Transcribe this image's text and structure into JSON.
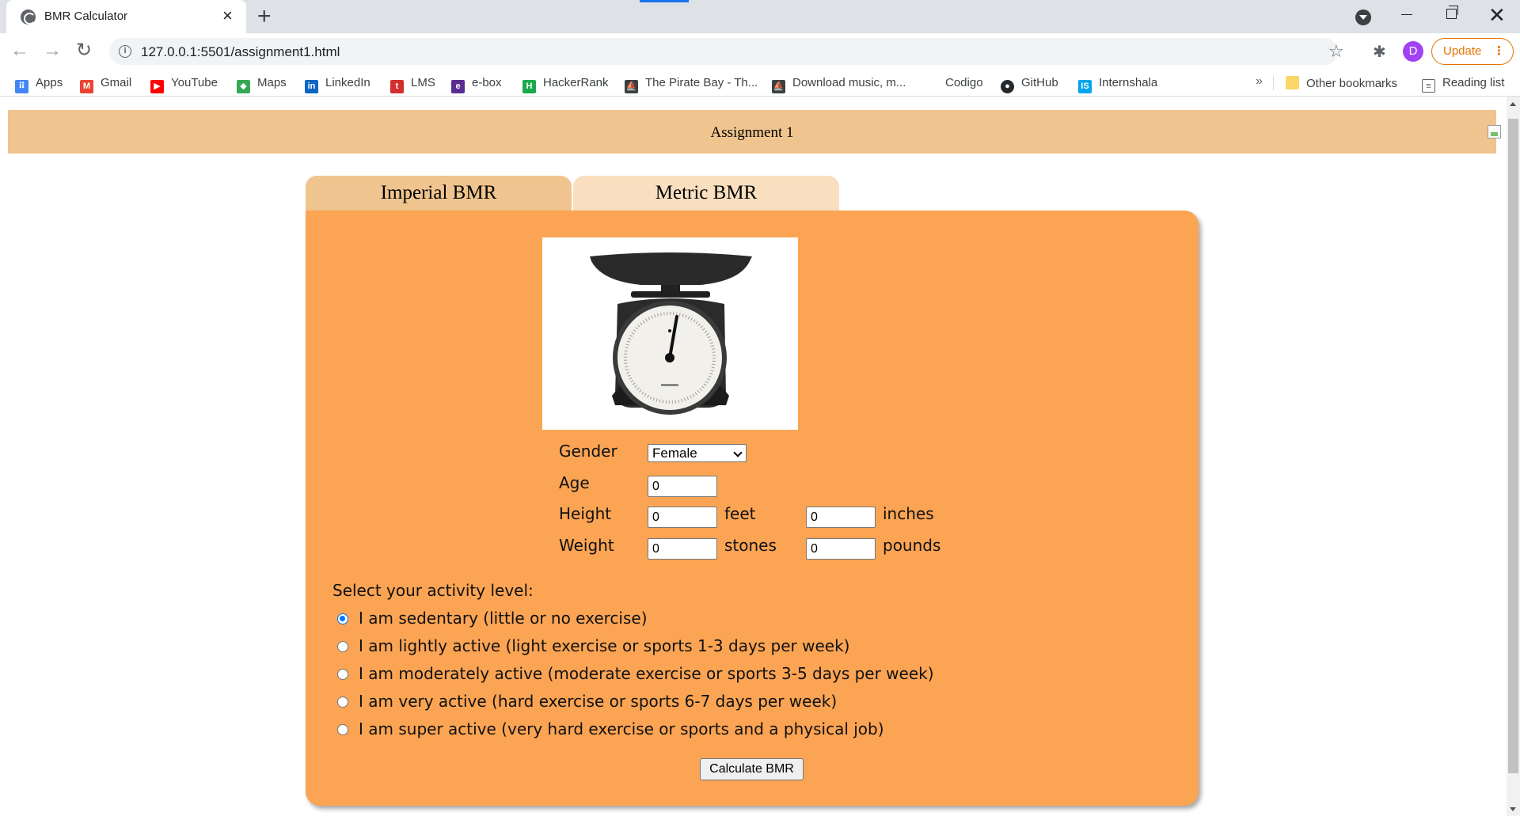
{
  "browser": {
    "tab_title": "BMR Calculator",
    "url": "127.0.0.1:5501/assignment1.html",
    "update_label": "Update",
    "profile_initial": "D"
  },
  "bookmarks": [
    {
      "label": "Apps",
      "icon": "apps-grid-icon",
      "color": "#4285f4"
    },
    {
      "label": "Gmail",
      "icon": "gmail-icon",
      "color": "#ea4335"
    },
    {
      "label": "YouTube",
      "icon": "youtube-icon",
      "color": "#ff0000"
    },
    {
      "label": "Maps",
      "icon": "maps-icon",
      "color": "#34a853"
    },
    {
      "label": "LinkedIn",
      "icon": "linkedin-icon",
      "color": "#0a66c2"
    },
    {
      "label": "LMS",
      "icon": "lms-icon",
      "color": "#d32f2f"
    },
    {
      "label": "e-box",
      "icon": "ebox-icon",
      "color": "#5c2d91"
    },
    {
      "label": "HackerRank",
      "icon": "hackerrank-icon",
      "color": "#1ba94c"
    },
    {
      "label": "The Pirate Bay - Th...",
      "icon": "pirate-ship-icon",
      "color": "#3c4043"
    },
    {
      "label": "Download music, m...",
      "icon": "pirate-ship-icon",
      "color": "#3c4043"
    },
    {
      "label": "Codigo",
      "icon": "",
      "color": ""
    },
    {
      "label": "GitHub",
      "icon": "github-icon",
      "color": "#24292e"
    },
    {
      "label": "Internshala",
      "icon": "internshala-icon",
      "color": "#00a5ec"
    }
  ],
  "bookmarks_right": {
    "other": "Other bookmarks",
    "reading": "Reading list"
  },
  "page": {
    "header_title": "Assignment 1",
    "tabs": [
      "Imperial BMR",
      "Metric BMR"
    ],
    "active_tab": "Imperial BMR"
  },
  "form": {
    "gender_label": "Gender",
    "gender_value": "Female",
    "age_label": "Age",
    "age_value": "0",
    "height_label": "Height",
    "height_feet": "0",
    "height_feet_unit": "feet",
    "height_inches": "0",
    "height_inches_unit": "inches",
    "weight_label": "Weight",
    "weight_stones": "0",
    "weight_stones_unit": "stones",
    "weight_pounds": "0",
    "weight_pounds_unit": "pounds"
  },
  "activity": {
    "title": "Select your activity level:",
    "options": [
      "I am sedentary (little or no exercise)",
      "I am lightly active (light exercise or sports 1-3 days per week)",
      "I am moderately active (moderate exercise or sports 3-5 days per week)",
      "I am very active (hard exercise or sports 6-7 days per week)",
      "I am super active (very hard exercise or sports and a physical job)"
    ],
    "selected_index": 0
  },
  "calculate_label": "Calculate BMR",
  "colors": {
    "header": "#f0c48e",
    "panel": "#fba454",
    "active_tab": "#f0c48e",
    "inactive_tab": "#f9dfbf"
  }
}
